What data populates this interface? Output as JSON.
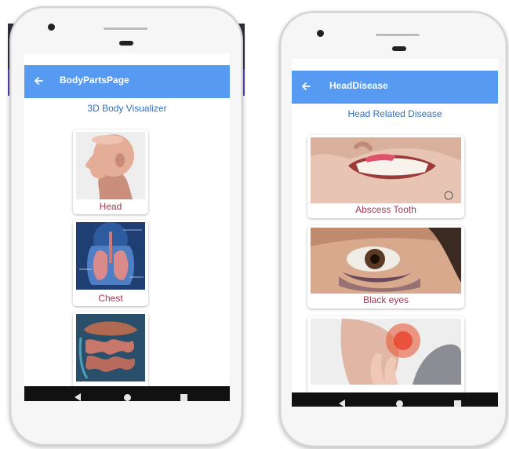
{
  "left_screen": {
    "title": "BodyPartsPage",
    "subtitle": "3D Body Visualizer",
    "items": [
      {
        "label": "Head"
      },
      {
        "label": "Chest"
      },
      {
        "label": ""
      }
    ]
  },
  "right_screen": {
    "title": "HeadDisease",
    "subtitle": "Head Related Disease",
    "items": [
      {
        "label": "Abscess Tooth"
      },
      {
        "label": "Black eyes"
      },
      {
        "label": ""
      }
    ]
  },
  "colors": {
    "app_bar": "#569af2",
    "subtitle_text": "#2f6fc2",
    "item_label": "#a33854",
    "nav_bar": "#111111"
  },
  "icons": {
    "back": "arrow-left-icon",
    "nav_back": "triangle-back-icon",
    "nav_home": "circle-home-icon",
    "nav_recent": "square-recent-icon"
  }
}
